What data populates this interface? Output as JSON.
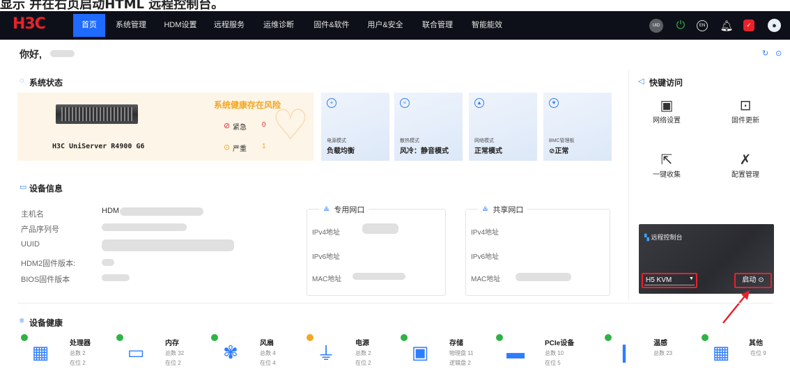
{
  "caption": "显示   并在右页启动HTML  远程控制台。",
  "nav": {
    "logo": "H3C",
    "items": [
      "首页",
      "系统管理",
      "HDM设置",
      "远程服务",
      "运维诊断",
      "固件&软件",
      "用户&安全",
      "联合管理",
      "智能能效"
    ],
    "active_index": 0,
    "right_icons": [
      "user-circle",
      "power",
      "language-en",
      "bell",
      "shield",
      "avatar"
    ]
  },
  "greeting": "你好,",
  "system_status": {
    "title": "系统状态",
    "server_name": "H3C UniServer R4900 G6",
    "health_text": "系统健康存在风险",
    "urgent_label": "紧急",
    "urgent_count": "0",
    "severe_label": "严重",
    "severe_count": "1",
    "cards": [
      {
        "small": "电源模式",
        "big": "负载均衡"
      },
      {
        "small": "散热模式",
        "big": "风冷：静音模式"
      },
      {
        "small": "网络模式",
        "big": "正常模式"
      },
      {
        "small": "BMC管理板",
        "big": "⊘正常"
      }
    ]
  },
  "quick_access": {
    "title": "快键访问",
    "items": [
      "网络设置",
      "固件更新",
      "一键收集",
      "配置管理"
    ]
  },
  "device_info": {
    "title": "设备信息",
    "labels": [
      "主机名",
      "产品序列号",
      "UUID",
      "HDM2固件版本:",
      "BIOS固件版本"
    ],
    "hostname_prefix": "HDM",
    "dedicated_port": {
      "title": "专用网口",
      "labels": [
        "IPv4地址",
        "IPv6地址",
        "MAC地址"
      ]
    },
    "shared_port": {
      "title": "共享网口",
      "labels": [
        "IPv4地址",
        "IPv6地址",
        "MAC地址"
      ]
    }
  },
  "remote_console": {
    "title": "远程控制台",
    "select_value": "H5 KVM",
    "launch_label": "启动"
  },
  "device_health": {
    "title": "设备健康",
    "items": [
      {
        "name": "处理器",
        "l1": "总数 2",
        "l2": "在位 2",
        "status": "ok"
      },
      {
        "name": "内存",
        "l1": "总数 32",
        "l2": "在位 2",
        "status": "ok"
      },
      {
        "name": "风扇",
        "l1": "总数 4",
        "l2": "在位 4",
        "status": "ok"
      },
      {
        "name": "电源",
        "l1": "总数 2",
        "l2": "在位 2",
        "status": "warn"
      },
      {
        "name": "存储",
        "l1": "物理盘 11",
        "l2": "逻辑盘 2",
        "status": "ok"
      },
      {
        "name": "PCIe设备",
        "l1": "总数 10",
        "l2": "在位 5",
        "status": "ok"
      },
      {
        "name": "温感",
        "l1": "总数 23",
        "l2": "",
        "status": "ok"
      },
      {
        "name": "其他",
        "l1": "在位 9",
        "l2": "",
        "status": "ok"
      }
    ]
  },
  "colors": {
    "accent": "#1f6bff",
    "danger": "#e8222b",
    "ok": "#2fb344",
    "warn": "#f5a623",
    "health_text": "#f5a623"
  }
}
